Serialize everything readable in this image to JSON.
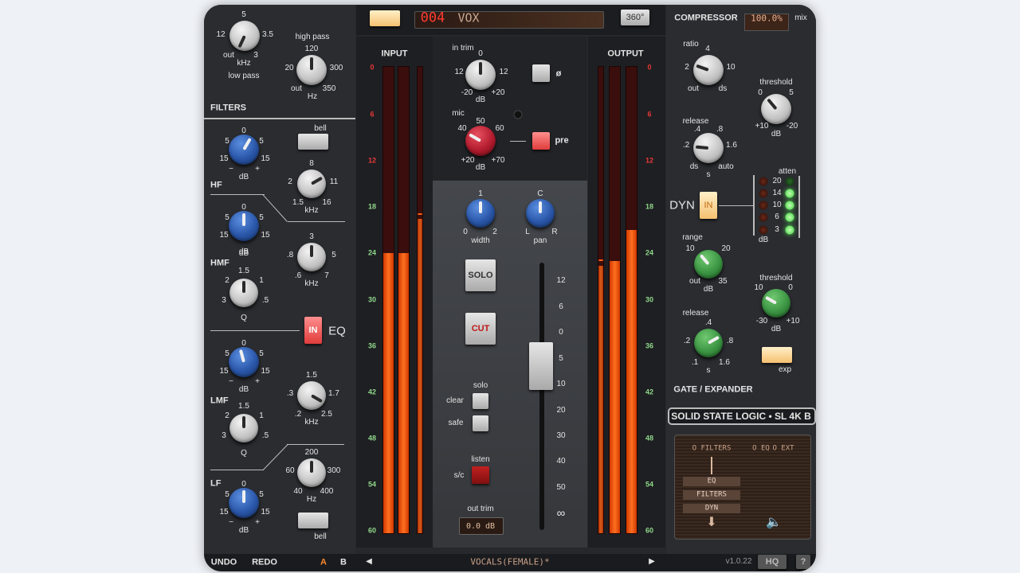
{
  "colors": {
    "accent": "#ff7020",
    "meter_red": "#e8383a",
    "meter_green": "#8fd88a",
    "led_green": "#50e050"
  },
  "header": {
    "power_icon": "power-icon",
    "preset_number": "004",
    "preset_name": "VOX",
    "view_360": "360°"
  },
  "filters": {
    "section": "FILTERS",
    "lowpass": {
      "title": "low pass",
      "scale": [
        "5",
        "12",
        "3.5",
        "out",
        "3"
      ],
      "unit": "kHz"
    },
    "highpass": {
      "title": "high pass",
      "scale": [
        "120",
        "20",
        "300",
        "out",
        "350"
      ],
      "unit": "Hz"
    }
  },
  "eq": {
    "label": "EQ",
    "in_label": "IN",
    "hf": {
      "label": "HF",
      "bell": "bell",
      "gain": {
        "scale": [
          "0",
          "5",
          "5",
          "15",
          "15",
          "−",
          "+"
        ],
        "unit": "dB"
      },
      "freq": {
        "scale": [
          "8",
          "2",
          "11",
          "1.5",
          "16"
        ],
        "unit": "kHz"
      }
    },
    "hmf": {
      "label": "HMF",
      "gain": {
        "scale": [
          "0",
          "5",
          "5",
          "15",
          "15"
        ],
        "unit": "dB"
      },
      "freq": {
        "scale": [
          "3",
          ".8",
          "5",
          ".6",
          "7"
        ],
        "unit": "kHz"
      },
      "q": {
        "scale": [
          "1.5",
          "2",
          "1",
          "3",
          ".5"
        ],
        "unit": "Q"
      }
    },
    "lmf": {
      "label": "LMF",
      "gain": {
        "scale": [
          "0",
          "5",
          "5",
          "15",
          "15",
          "−",
          "+"
        ],
        "unit": "dB"
      },
      "freq": {
        "scale": [
          "1.5",
          ".3",
          "1.7",
          ".2",
          "2.5"
        ],
        "unit": "kHz"
      },
      "q": {
        "scale": [
          "1.5",
          "2",
          "1",
          "3",
          ".5"
        ],
        "unit": "Q"
      }
    },
    "lf": {
      "label": "LF",
      "bell": "bell",
      "gain": {
        "scale": [
          "0",
          "5",
          "5",
          "15",
          "15",
          "−",
          "+"
        ],
        "unit": "dB"
      },
      "freq": {
        "scale": [
          "200",
          "60",
          "300",
          "40",
          "400"
        ],
        "unit": "Hz"
      }
    }
  },
  "meters": {
    "input_label": "INPUT",
    "output_label": "OUTPUT",
    "scale": [
      "0",
      "6",
      "12",
      "18",
      "24",
      "30",
      "36",
      "42",
      "48",
      "54",
      "60"
    ],
    "input_level_db": [
      -24,
      -24,
      -19
    ],
    "output_level_db": [
      -25,
      -25,
      -21
    ]
  },
  "channel": {
    "in_trim": {
      "title": "in trim",
      "scale": [
        "0",
        "12",
        "12",
        "-20",
        "+20"
      ],
      "unit": "dB"
    },
    "phase": "ø",
    "mic": {
      "title": "mic",
      "scale": [
        "50",
        "40",
        "60",
        "+20",
        "+70"
      ],
      "unit": "dB"
    },
    "pre": "pre",
    "width": {
      "scale": [
        "1",
        "0",
        "2"
      ],
      "title": "width"
    },
    "pan": {
      "scale": [
        "C",
        "L",
        "R"
      ],
      "title": "pan"
    },
    "solo": "SOLO",
    "cut": "CUT",
    "solo_group": "solo",
    "clear": "clear",
    "safe": "safe",
    "listen": "listen",
    "sc": "s/c",
    "out_trim": "out trim",
    "out_trim_value": "0.0 dB",
    "fader_scale": [
      "12",
      "6",
      "0",
      "5",
      "10",
      "20",
      "30",
      "40",
      "50",
      "∞"
    ]
  },
  "compressor": {
    "title": "COMPRESSOR",
    "mix_value": "100.0%",
    "mix": "mix",
    "ratio": {
      "title": "ratio",
      "scale": [
        "4",
        "2",
        "10",
        "out",
        "ds"
      ]
    },
    "threshold": {
      "title": "threshold",
      "scale": [
        "0",
        "5",
        "+10",
        "-20"
      ],
      "unit": "dB"
    },
    "release": {
      "title": "release",
      "scale": [
        ".4",
        ".8",
        ".2",
        "1.6",
        "ds",
        "auto"
      ],
      "unit": "s"
    }
  },
  "dyn": {
    "label": "DYN",
    "in": "IN",
    "atten": "atten",
    "atten_scale": [
      "20",
      "14",
      "10",
      "6",
      "3"
    ],
    "unit": "dB",
    "atten_active": [
      false,
      true,
      true,
      true,
      true
    ]
  },
  "gate": {
    "title": "GATE / EXPANDER",
    "range": {
      "title": "range",
      "scale": [
        "10",
        "20",
        "out",
        "35"
      ],
      "unit": "dB"
    },
    "threshold": {
      "title": "threshold",
      "scale": [
        "10",
        "0",
        "-30",
        "+10"
      ],
      "unit": "dB"
    },
    "release": {
      "title": "release",
      "scale": [
        ".4",
        ".2",
        ".8",
        ".1",
        "1.6"
      ],
      "unit": "s"
    },
    "exp": "exp"
  },
  "brand": "SOLID STATE LOGIC • SL 4K B",
  "routing": {
    "options": [
      "O FILTERS",
      "O EQ",
      "O EXT"
    ],
    "chain": [
      "EQ",
      "FILTERS",
      "DYN"
    ]
  },
  "footer": {
    "undo": "UNDO",
    "redo": "REDO",
    "a": "A",
    "b": "B",
    "prev": "◀",
    "preset": "VOCALS(FEMALE)*",
    "next": "▶",
    "version": "v1.0.22",
    "hq": "HQ",
    "help": "?"
  }
}
